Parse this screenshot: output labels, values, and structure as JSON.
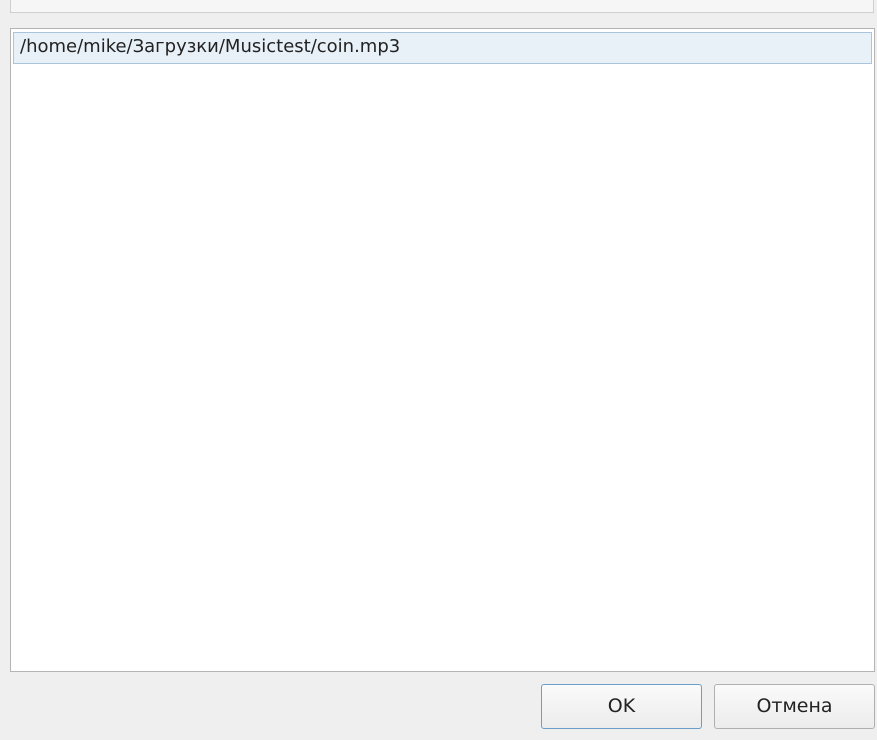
{
  "file_list": {
    "items": [
      {
        "path": "/home/mike/Загрузки/Musictest/coin.mp3",
        "selected": true
      }
    ]
  },
  "buttons": {
    "ok_label": "OK",
    "cancel_label": "Отмена"
  },
  "colors": {
    "selection_bg": "#e8f0f8",
    "selection_border": "#a9c4dc",
    "default_button_border": "#6b9ec8"
  }
}
